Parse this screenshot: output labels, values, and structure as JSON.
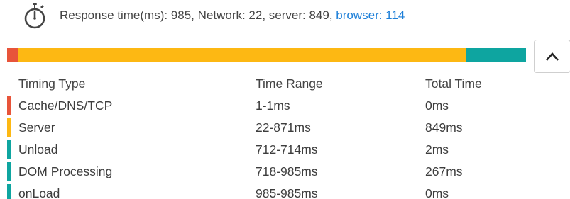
{
  "summary": {
    "text": "Response time(ms): 985, Network: 22, server: 849, ",
    "browser_link": "browser: 114"
  },
  "icons": {
    "stopwatch": "stopwatch-icon",
    "collapse": "chevron-up-icon"
  },
  "timing_bar": [
    {
      "name": "network",
      "value": 22,
      "color": "#e8543a"
    },
    {
      "name": "server",
      "value": 849,
      "color": "#fdb813"
    },
    {
      "name": "browser",
      "value": 114,
      "color": "#0ea5a0"
    }
  ],
  "table": {
    "headers": [
      "Timing Type",
      "Time Range",
      "Total Time"
    ],
    "rows": [
      {
        "type": "Cache/DNS/TCP",
        "range": "1-1ms",
        "total": "0ms",
        "color": "#e8543a"
      },
      {
        "type": "Server",
        "range": "22-871ms",
        "total": "849ms",
        "color": "#fdb813"
      },
      {
        "type": "Unload",
        "range": "712-714ms",
        "total": "2ms",
        "color": "#0ea5a0"
      },
      {
        "type": "DOM Processing",
        "range": "718-985ms",
        "total": "267ms",
        "color": "#0ea5a0"
      },
      {
        "type": "onLoad",
        "range": "985-985ms",
        "total": "0ms",
        "color": "#0ea5a0"
      }
    ]
  }
}
